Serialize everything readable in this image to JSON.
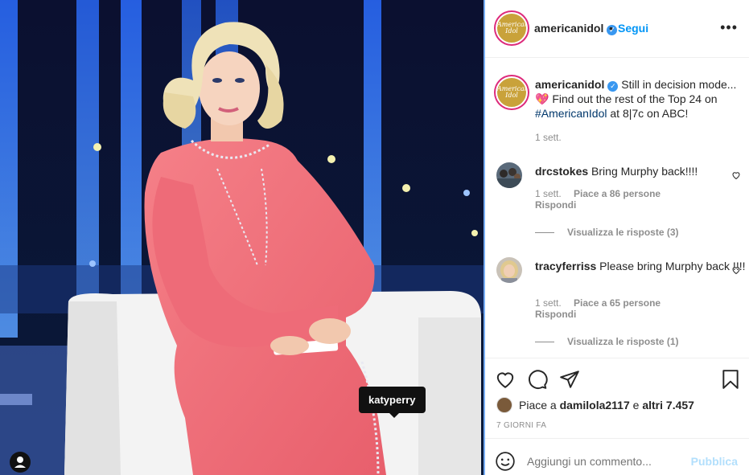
{
  "post": {
    "username": "americanidol",
    "follow_label": "Segui",
    "more_label": "•••",
    "avatar_text": "American Idol",
    "photo_tag": "katyperry"
  },
  "caption": {
    "username": "americanidol",
    "text": "Still in decision mode...",
    "line2_emoji": "💖",
    "line2_text": "Find out the rest of the Top 24 on",
    "hashtag": "#AmericanIdol",
    "line3_text": "at 8|7c on ABC!",
    "time": "1 sett."
  },
  "comments": [
    {
      "username": "drcstokes",
      "text": "Bring Murphy back!!!!",
      "time": "1 sett.",
      "likes": "Piace a 86 persone",
      "reply_label": "Rispondi",
      "view_replies": "Visualizza le risposte (3)"
    },
    {
      "username": "tracyferriss",
      "text": "Please bring Murphy back !!!!",
      "time": "1 sett.",
      "likes": "Piace a 65 persone",
      "reply_label": "Rispondi",
      "view_replies": "Visualizza le risposte (1)"
    }
  ],
  "likes": {
    "prefix": "Piace a",
    "user": "damilola2117",
    "connector": "e",
    "others": "altri 7.457"
  },
  "date": "7 GIORNI FA",
  "comment_input": {
    "placeholder": "Aggiungi un commento...",
    "publish_label": "Pubblica"
  },
  "colors": {
    "accent": "#0095f6",
    "publish_disabled": "#b2dffc",
    "muted": "#8e8e8e",
    "suit_pink": "#f0717a"
  },
  "icons": [
    "more-icon",
    "verified-icon",
    "heart-icon",
    "comment-icon",
    "share-icon",
    "bookmark-icon",
    "smile-icon",
    "tag-user-icon"
  ]
}
